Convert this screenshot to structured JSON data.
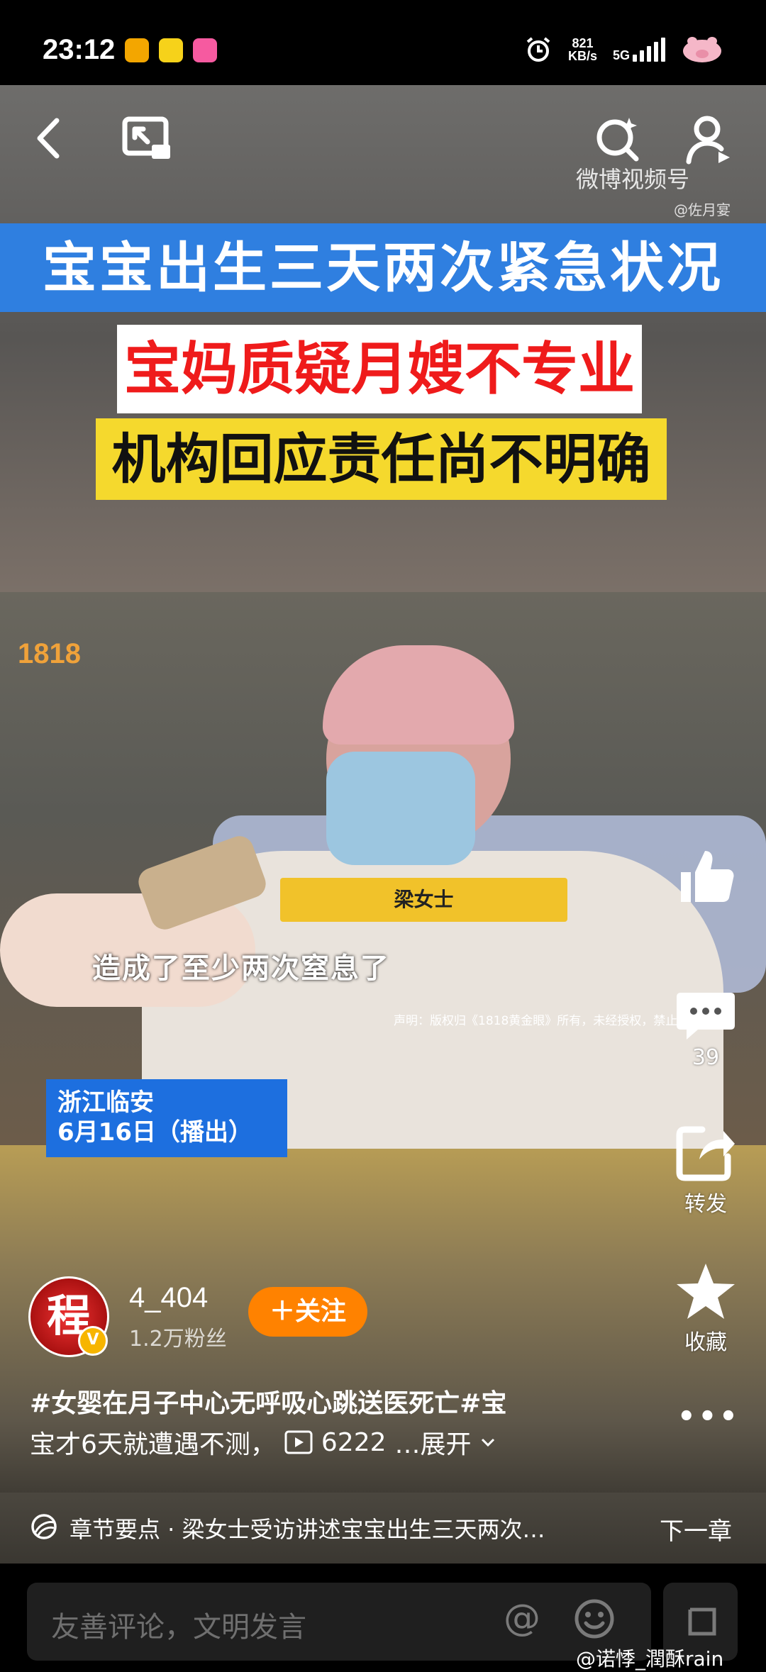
{
  "status_bar": {
    "time": "23:12",
    "net_speed_value": "821",
    "net_speed_unit": "KB/s",
    "network": "5G"
  },
  "video": {
    "headline_1": "宝宝出生三天两次紧急状况",
    "headline_2": "宝妈质疑月嫂不专业",
    "headline_3": "机构回应责任尚不明确",
    "watermark": "微博视频号",
    "watermark_sub": "@佐月宴",
    "channel_logo": "1818",
    "name_tag": "梁女士",
    "subtitle": "造成了至少两次窒息了",
    "disclaimer": "声明：版权归《1818黄金眼》所有，未经授权，禁止转载",
    "location_line1": "浙江临安",
    "location_line2": "6月16日（播出）"
  },
  "actions": {
    "comment_count": "39",
    "share_label": "转发",
    "favorite_label": "收藏"
  },
  "author": {
    "avatar_char": "程",
    "name": "4_404",
    "fans": "1.2万粉丝",
    "follow_label": "＋关注"
  },
  "description": {
    "line1": "#女婴在月子中心无呼吸心跳送医死亡#宝",
    "line2": "宝才6天就遭遇不测，",
    "views": "6222",
    "expand": "…展开"
  },
  "chapter": {
    "text": "章节要点 · 梁女士受访讲述宝宝出生三天两次…",
    "next": "下一章"
  },
  "comment_bar": {
    "placeholder": "友善评论，文明发言",
    "at": "@"
  },
  "corner_watermark": "@诺悸_潤酥rain"
}
